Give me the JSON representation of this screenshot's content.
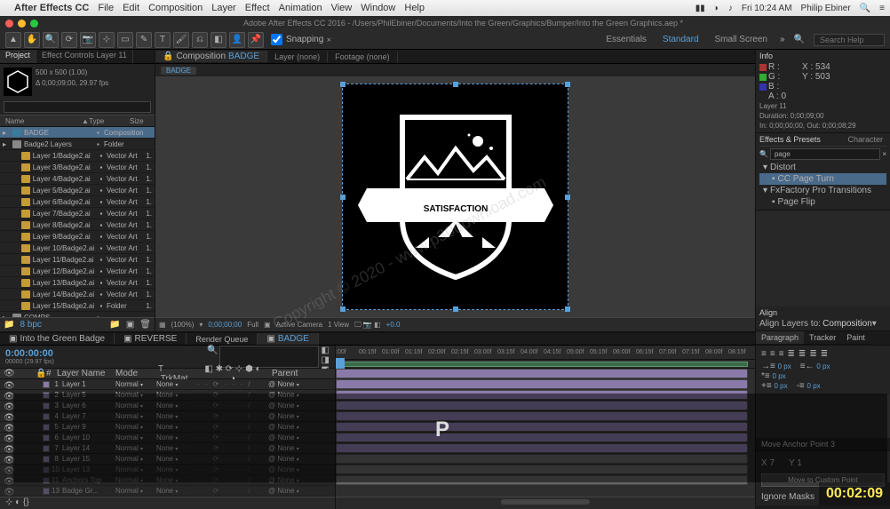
{
  "mac_menu": {
    "apple": "",
    "app": "After Effects CC",
    "items": [
      "File",
      "Edit",
      "Composition",
      "Layer",
      "Effect",
      "Animation",
      "View",
      "Window",
      "Help"
    ],
    "right_time": "Fri 10:24 AM",
    "user": "Philip Ebiner"
  },
  "titlebar": {
    "text": "Adobe After Effects CC 2016 - /Users/PhilEbiner/Documents/Into the Green/Graphics/Bumper/Into the Green Graphics.aep *"
  },
  "toolbar": {
    "snapping": "Snapping",
    "workspaces": [
      "Essentials",
      "Standard",
      "Small Screen"
    ],
    "active_workspace": "Standard",
    "search_placeholder": "Search Help"
  },
  "project_panel": {
    "tab": "Project",
    "ec_tab": "Effect Controls Layer 11",
    "thumb_info1": "500 x 500 (1.00)",
    "thumb_info2": "Δ 0;00;09;00, 29.97 fps",
    "name_header": "Name",
    "type_header": "Type",
    "size_header": "Size",
    "bpc": "8 bpc",
    "items": [
      {
        "name": "BADGE",
        "type": "Composition",
        "selected": true,
        "icon": "comp"
      },
      {
        "name": "Badge2 Layers",
        "type": "Folder",
        "icon": "folder"
      },
      {
        "name": "Layer 1/Badge2.ai",
        "type": "Vector Art",
        "size": "1."
      },
      {
        "name": "Layer 3/Badge2.ai",
        "type": "Vector Art",
        "size": "1."
      },
      {
        "name": "Layer 4/Badge2.ai",
        "type": "Vector Art",
        "size": "1."
      },
      {
        "name": "Layer 5/Badge2.ai",
        "type": "Vector Art",
        "size": "1."
      },
      {
        "name": "Layer 6/Badge2.ai",
        "type": "Vector Art",
        "size": "1."
      },
      {
        "name": "Layer 7/Badge2.ai",
        "type": "Vector Art",
        "size": "1."
      },
      {
        "name": "Layer 8/Badge2.ai",
        "type": "Vector Art",
        "size": "1."
      },
      {
        "name": "Layer 9/Badge2.ai",
        "type": "Vector Art",
        "size": "1."
      },
      {
        "name": "Layer 10/Badge2.ai",
        "type": "Vector Art",
        "size": "1."
      },
      {
        "name": "Layer 11/Badge2.ai",
        "type": "Vector Art",
        "size": "1."
      },
      {
        "name": "Layer 12/Badge2.ai",
        "type": "Vector Art",
        "size": "1."
      },
      {
        "name": "Layer 13/Badge2.ai",
        "type": "Vector Art",
        "size": "1."
      },
      {
        "name": "Layer 14/Badge2.ai",
        "type": "Vector Art",
        "size": "1."
      },
      {
        "name": "Layer 15/Badge2.ai",
        "type": "Folder",
        "size": "1."
      },
      {
        "name": "COMPS",
        "type": "",
        "icon": "folder"
      }
    ]
  },
  "viewer": {
    "tabs": [
      {
        "label": "Composition",
        "name": "BADGE",
        "active": true
      },
      {
        "label": "Layer (none)",
        "active": false
      },
      {
        "label": "Footage (none)",
        "active": false
      }
    ],
    "crumb": "BADGE",
    "badge_text": "SATISFACTION",
    "footer": {
      "mag": "(100%)",
      "tc": "0;00;00;00",
      "res": "Full",
      "camera": "Active Camera",
      "views": "1 View",
      "exposure": "+0.0"
    }
  },
  "info_panel": {
    "title": "Info",
    "r": "R :",
    "g": "G :",
    "b": "B :",
    "a": "A : 0",
    "x": "X : 534",
    "y": "Y : 503",
    "layer": "Layer 11",
    "duration": "Duration: 0;00;09;00",
    "inout": "In: 0;00;00;00, Out: 0;00;08;29"
  },
  "effects_panel": {
    "title": "Effects & Presets",
    "char_tab": "Character",
    "search": "page",
    "items": [
      {
        "label": "Distort",
        "indent": 0
      },
      {
        "label": "CC Page Turn",
        "indent": 1,
        "selected": true
      },
      {
        "label": "FxFactory Pro Transitions",
        "indent": 0
      },
      {
        "label": "Page Flip",
        "indent": 1
      }
    ]
  },
  "align_panel": {
    "title": "Align",
    "layers_to": "Align Layers to:",
    "target": "Composition"
  },
  "paragraph_panel": {
    "title": "Paragraph",
    "tracker": "Tracker",
    "paint": "Paint",
    "px": "0 px"
  },
  "timeline": {
    "tabs": [
      {
        "label": "Into the Green Badge"
      },
      {
        "label": "REVERSE"
      },
      {
        "label": "Render Queue"
      },
      {
        "label": "BADGE",
        "active": true
      }
    ],
    "timecode": "0:00:00:00",
    "tc_sub": "00000 (29.97 fps)",
    "col_layer": "Layer Name",
    "col_mode": "Mode",
    "col_trkmat": "T .TrkMat",
    "col_parent": "Parent",
    "ruler_ticks": [
      ":00f",
      "00:15f",
      "01:00f",
      "01:15f",
      "02:00f",
      "02:15f",
      "03:00f",
      "03:15f",
      "04:00f",
      "04:15f",
      "05:00f",
      "05:15f",
      "06:00f",
      "06:15f",
      "07:00f",
      "07:15f",
      "08:00f",
      "08:15f"
    ],
    "layers": [
      {
        "n": 1,
        "name": "Layer 1",
        "mode": "Normal",
        "trkmat": "None",
        "parent": "None"
      },
      {
        "n": 2,
        "name": "Layer 5",
        "mode": "Normal",
        "trkmat": "None",
        "parent": "None"
      },
      {
        "n": 3,
        "name": "Layer 6",
        "mode": "Normal",
        "trkmat": "None",
        "parent": "None"
      },
      {
        "n": 4,
        "name": "Layer 7",
        "mode": "Normal",
        "trkmat": "None",
        "parent": "None"
      },
      {
        "n": 5,
        "name": "Layer 9",
        "mode": "Normal",
        "trkmat": "None",
        "parent": "None"
      },
      {
        "n": 6,
        "name": "Layer 10",
        "mode": "Normal",
        "trkmat": "None",
        "parent": "None"
      },
      {
        "n": 7,
        "name": "Layer 14",
        "mode": "Normal",
        "trkmat": "None",
        "parent": "None"
      },
      {
        "n": 8,
        "name": "Layer 15",
        "mode": "Normal",
        "trkmat": "None",
        "parent": "None"
      },
      {
        "n": 10,
        "name": "Layer 13",
        "mode": "Normal",
        "trkmat": "None",
        "parent": "None",
        "dim": true
      },
      {
        "n": 11,
        "name": "Anchors Top",
        "mode": "Normal",
        "trkmat": "None",
        "parent": "None",
        "dim": true
      },
      {
        "n": 13,
        "name": "Badge Gr...",
        "mode": "Normal",
        "trkmat": "None",
        "parent": "None",
        "dim": true
      }
    ]
  },
  "anchor_panel": {
    "title": "Move Anchor Point 3",
    "x": "X",
    "x_val": "7",
    "y": "Y",
    "y_val": "1",
    "btn": "Move to Custom Point",
    "ignore": "Ignore Masks"
  },
  "bottom_tc": "00:02:09",
  "watermark": "Copyright © 2020 - www.p30download.com",
  "overlay_key": "P"
}
